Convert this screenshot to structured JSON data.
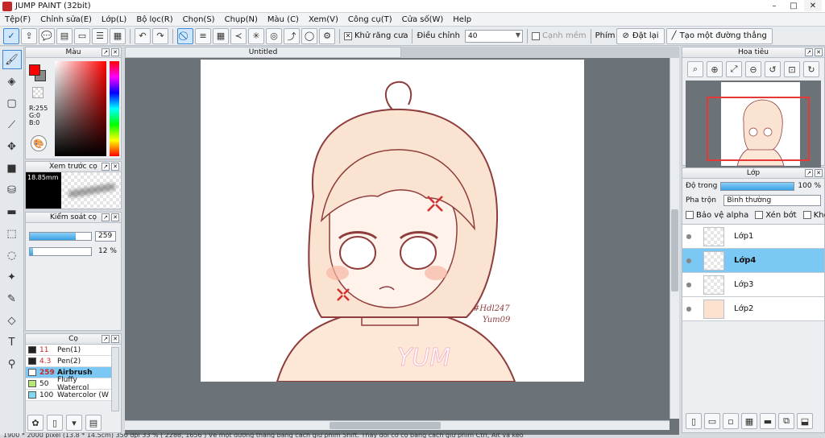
{
  "window": {
    "title": "JUMP PAINT (32bit)",
    "controls": [
      "–",
      "□",
      "✕"
    ]
  },
  "menu": [
    "Tệp(F)",
    "Chỉnh sửa(E)",
    "Lớp(L)",
    "Bộ lọc(R)",
    "Chọn(S)",
    "Chụp(N)",
    "Màu (C)",
    "Xem(V)",
    "Công cụ(T)",
    "Cửa số(W)",
    "Help"
  ],
  "toolbar": {
    "antialias_label": "Khử răng cưa",
    "adjust_label": "Điều chỉnh",
    "adjust_value": "40",
    "edge_label": "Cạnh mềm",
    "key_label": "Phím",
    "reset_label": "Đặt lại",
    "line_label": "Tạo một đường thẳng"
  },
  "color_panel": {
    "title": "Màu",
    "r": "R:255",
    "g": "G:0",
    "b": "B:0",
    "primary": "#ff0000",
    "secondary": "#8a8a8a"
  },
  "brush_preview": {
    "title": "Xem trước cọ",
    "size": "18.85mm"
  },
  "brush_control": {
    "title": "Kiểm soát cọ",
    "size_value": "259",
    "opacity_value": "12 %",
    "size_level": 0.75,
    "opacity_level": 0.05
  },
  "brushes": {
    "title": "Cọ",
    "items": [
      {
        "size": "11",
        "name": "Pen(1)",
        "color": "#222222"
      },
      {
        "size": "4.3",
        "name": "Pen(2)",
        "color": "#222222"
      },
      {
        "size": "259",
        "name": "Airbrush",
        "color": "#ffffff"
      },
      {
        "size": "50",
        "name": "Fluffy Watercol",
        "color": "#b7e67a"
      },
      {
        "size": "100",
        "name": "Watercolor (W",
        "color": "#84d8ee"
      }
    ]
  },
  "document": {
    "tab": "Untitled",
    "watermark": "YUM",
    "signature_line1": "#Hdl247",
    "signature_line2": "Yum09"
  },
  "navigator": {
    "title": "Hoa tiêu"
  },
  "layers": {
    "title": "Lớp",
    "opacity_label": "Độ trong",
    "opacity_value": "100 %",
    "blend_label": "Pha trộn",
    "blend_value": "Bình thường",
    "protect_alpha": "Bảo vệ alpha",
    "clipping": "Xén bớt",
    "lock": "Khóa",
    "items": [
      {
        "name": "Lớp1",
        "selected": false
      },
      {
        "name": "Lớp4",
        "selected": true
      },
      {
        "name": "Lớp3",
        "selected": false
      },
      {
        "name": "Lớp2",
        "selected": false
      }
    ]
  },
  "status": {
    "text": "1900 * 2000 pixel  (13.8 * 14.5cm)   350 dpi   33 %   ( 2288, 1656 )   Vẽ một đường thẳng bằng cách giữ phím Shift. Thay đổi cỡ cọ bằng cách giữ phím Ctrl, Alt và kéo"
  }
}
